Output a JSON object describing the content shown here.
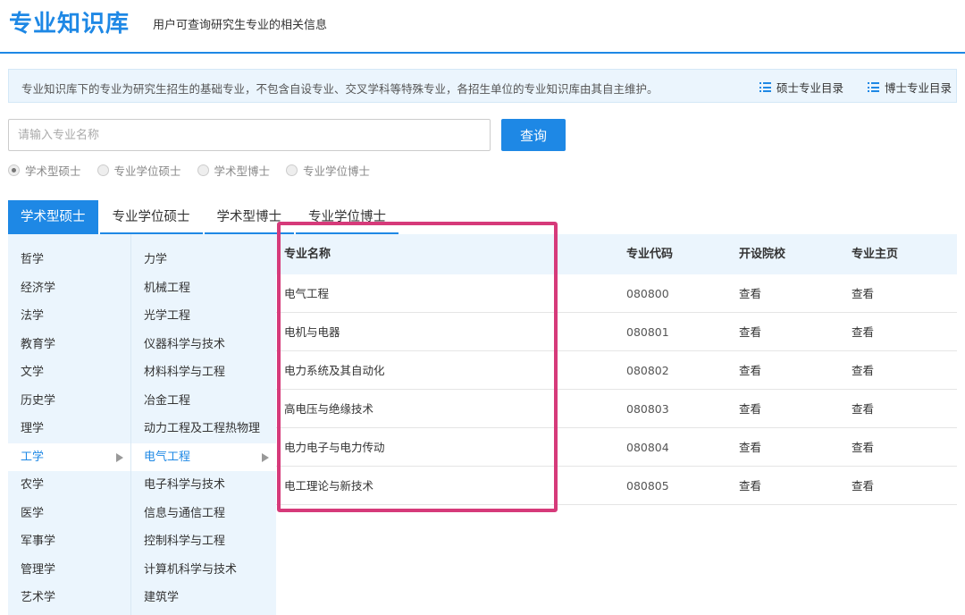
{
  "header": {
    "title": "专业知识库",
    "subtitle": "用户可查询研究生专业的相关信息"
  },
  "notice": {
    "text": "专业知识库下的专业为研究生招生的基础专业，不包含自设专业、交叉学科等特殊专业，各招生单位的专业知识库由其自主维护。",
    "master_link": "硕士专业目录",
    "doctor_link": "博士专业目录",
    "link_icon": "list-icon"
  },
  "search": {
    "placeholder": "请输入专业名称",
    "value": "",
    "button": "查询"
  },
  "radios": [
    {
      "label": "学术型硕士",
      "checked": true
    },
    {
      "label": "专业学位硕士",
      "checked": false
    },
    {
      "label": "学术型博士",
      "checked": false
    },
    {
      "label": "专业学位博士",
      "checked": false
    }
  ],
  "tabs": [
    {
      "label": "学术型硕士",
      "active": true
    },
    {
      "label": "专业学位硕士",
      "active": false
    },
    {
      "label": "学术型博士",
      "active": false
    },
    {
      "label": "专业学位博士",
      "active": false
    }
  ],
  "categories": [
    {
      "label": "哲学"
    },
    {
      "label": "经济学"
    },
    {
      "label": "法学"
    },
    {
      "label": "教育学"
    },
    {
      "label": "文学"
    },
    {
      "label": "历史学"
    },
    {
      "label": "理学"
    },
    {
      "label": "工学",
      "active": true
    },
    {
      "label": "农学"
    },
    {
      "label": "医学"
    },
    {
      "label": "军事学"
    },
    {
      "label": "管理学"
    },
    {
      "label": "艺术学"
    }
  ],
  "disciplines": [
    {
      "label": "力学"
    },
    {
      "label": "机械工程"
    },
    {
      "label": "光学工程"
    },
    {
      "label": "仪器科学与技术"
    },
    {
      "label": "材料科学与工程"
    },
    {
      "label": "冶金工程"
    },
    {
      "label": "动力工程及工程热物理"
    },
    {
      "label": "电气工程",
      "active": true
    },
    {
      "label": "电子科学与技术"
    },
    {
      "label": "信息与通信工程"
    },
    {
      "label": "控制科学与工程"
    },
    {
      "label": "计算机科学与技术"
    },
    {
      "label": "建筑学"
    }
  ],
  "table": {
    "headers": {
      "name": "专业名称",
      "code": "专业代码",
      "school": "开设院校",
      "home": "专业主页"
    },
    "rows": [
      {
        "name": "电气工程",
        "code": "080800",
        "school": "查看",
        "home": "查看"
      },
      {
        "name": "电机与电器",
        "code": "080801",
        "school": "查看",
        "home": "查看"
      },
      {
        "name": "电力系统及其自动化",
        "code": "080802",
        "school": "查看",
        "home": "查看"
      },
      {
        "name": "高电压与绝缘技术",
        "code": "080803",
        "school": "查看",
        "home": "查看"
      },
      {
        "name": "电力电子与电力传动",
        "code": "080804",
        "school": "查看",
        "home": "查看"
      },
      {
        "name": "电工理论与新技术",
        "code": "080805",
        "school": "查看",
        "home": "查看"
      }
    ]
  },
  "colors": {
    "accent": "#1e88e5",
    "panel": "#ebf5fd",
    "highlight": "#d63a7a"
  }
}
